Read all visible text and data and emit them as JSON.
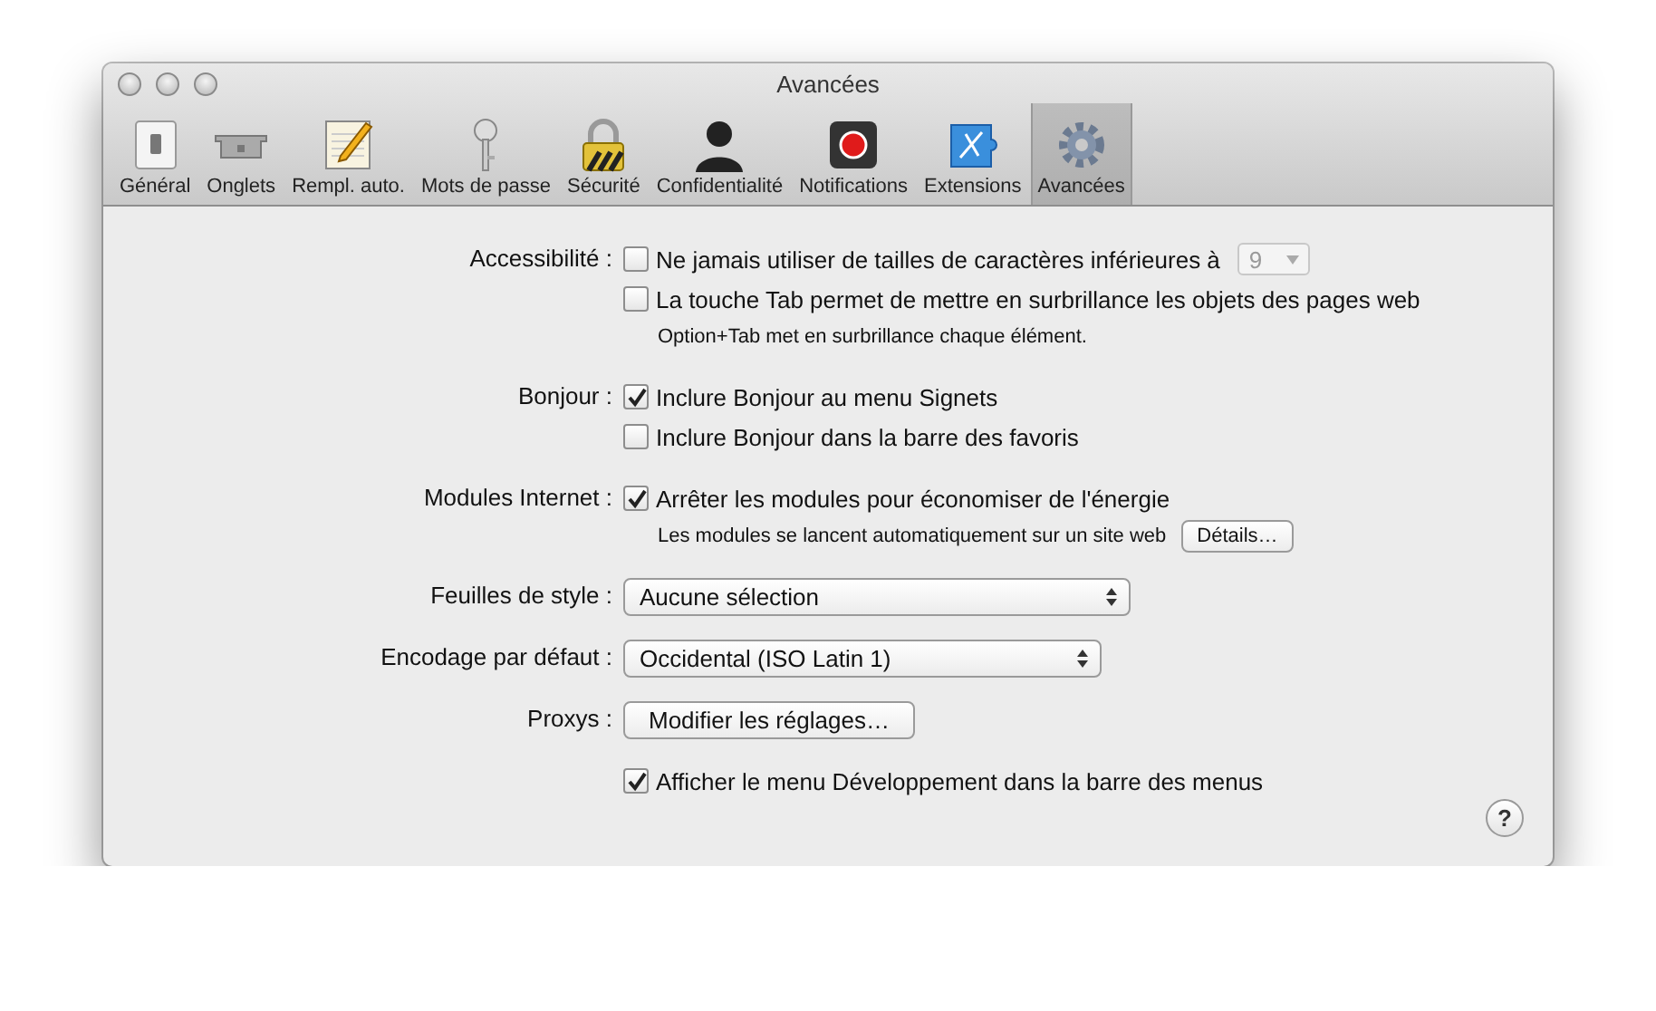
{
  "window": {
    "title": "Avancées"
  },
  "toolbar": [
    {
      "label": "Général",
      "selected": false
    },
    {
      "label": "Onglets",
      "selected": false
    },
    {
      "label": "Rempl. auto.",
      "selected": false
    },
    {
      "label": "Mots de passe",
      "selected": false
    },
    {
      "label": "Sécurité",
      "selected": false
    },
    {
      "label": "Confidentialité",
      "selected": false
    },
    {
      "label": "Notifications",
      "selected": false
    },
    {
      "label": "Extensions",
      "selected": false
    },
    {
      "label": "Avancées",
      "selected": true
    }
  ],
  "sections": [
    {
      "label": "Accessibilité :",
      "controls": [
        {
          "kind": "checkbox",
          "label": "Ne jamais utiliser de tailles de caractères inférieures à",
          "checked": false,
          "popup": {
            "value": "9",
            "disabled": true
          }
        },
        {
          "kind": "checkbox",
          "label": "La touche Tab permet de mettre en surbrillance les objets des pages web",
          "checked": false
        },
        {
          "kind": "note",
          "text": "Option+Tab met en surbrillance chaque élément."
        }
      ]
    },
    {
      "label": "Bonjour :",
      "controls": [
        {
          "kind": "checkbox",
          "label": "Inclure Bonjour au menu Signets",
          "checked": true
        },
        {
          "kind": "checkbox",
          "label": "Inclure Bonjour dans la barre des favoris",
          "checked": false
        }
      ]
    },
    {
      "label": "Modules Internet :",
      "controls": [
        {
          "kind": "checkbox",
          "label": "Arrêter les modules pour économiser de l'énergie",
          "checked": true
        },
        {
          "kind": "note",
          "text": "Les modules se lancent automatiquement sur un site web",
          "button": "Détails…"
        }
      ]
    },
    {
      "label": "Feuilles de style :",
      "controls": [
        {
          "kind": "select",
          "value": "Aucune sélection",
          "wide": true
        }
      ]
    },
    {
      "label": "Encodage par défaut :",
      "controls": [
        {
          "kind": "select",
          "value": "Occidental (ISO Latin 1)",
          "wide": false
        }
      ]
    },
    {
      "label": "Proxys :",
      "controls": [
        {
          "kind": "button",
          "label": "Modifier les réglages…"
        }
      ]
    },
    {
      "controls": [
        {
          "kind": "checkbox",
          "label": "Afficher le menu Développement dans la barre des menus",
          "checked": true
        }
      ]
    }
  ],
  "help": "?"
}
